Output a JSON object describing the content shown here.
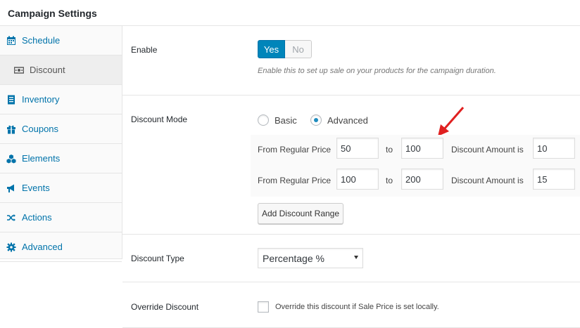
{
  "panel": {
    "title": "Campaign Settings"
  },
  "sidebar": {
    "items": [
      {
        "label": "Schedule",
        "icon": "calendar-icon"
      },
      {
        "label": "Discount",
        "icon": "money-icon",
        "active": true
      },
      {
        "label": "Inventory",
        "icon": "file-list-icon"
      },
      {
        "label": "Coupons",
        "icon": "gift-icon"
      },
      {
        "label": "Elements",
        "icon": "cubes-icon"
      },
      {
        "label": "Events",
        "icon": "bullhorn-icon"
      },
      {
        "label": "Actions",
        "icon": "shuffle-icon"
      },
      {
        "label": "Advanced",
        "icon": "gear-icon"
      }
    ]
  },
  "enable": {
    "label": "Enable",
    "yes": "Yes",
    "no": "No",
    "selected": "Yes",
    "hint": "Enable this to set up sale on your products for the campaign duration."
  },
  "discount_mode": {
    "label": "Discount Mode",
    "options": [
      "Basic",
      "Advanced"
    ],
    "selected": "Advanced",
    "ranges": [
      {
        "from_label": "From Regular Price",
        "from": "50",
        "to_label": "to",
        "to": "100",
        "amount_label": "Discount Amount is",
        "amount": "10"
      },
      {
        "from_label": "From Regular Price",
        "from": "100",
        "to_label": "to",
        "to": "200",
        "amount_label": "Discount Amount is",
        "amount": "15"
      }
    ],
    "add_button": "Add Discount Range"
  },
  "discount_type": {
    "label": "Discount Type",
    "value": "Percentage %"
  },
  "override": {
    "label": "Override Discount",
    "checkbox_label": "Override this discount if Sale Price is set locally.",
    "checked": false
  },
  "colors": {
    "accent": "#0085ba",
    "link": "#0073aa",
    "arrow": "#e02020"
  }
}
